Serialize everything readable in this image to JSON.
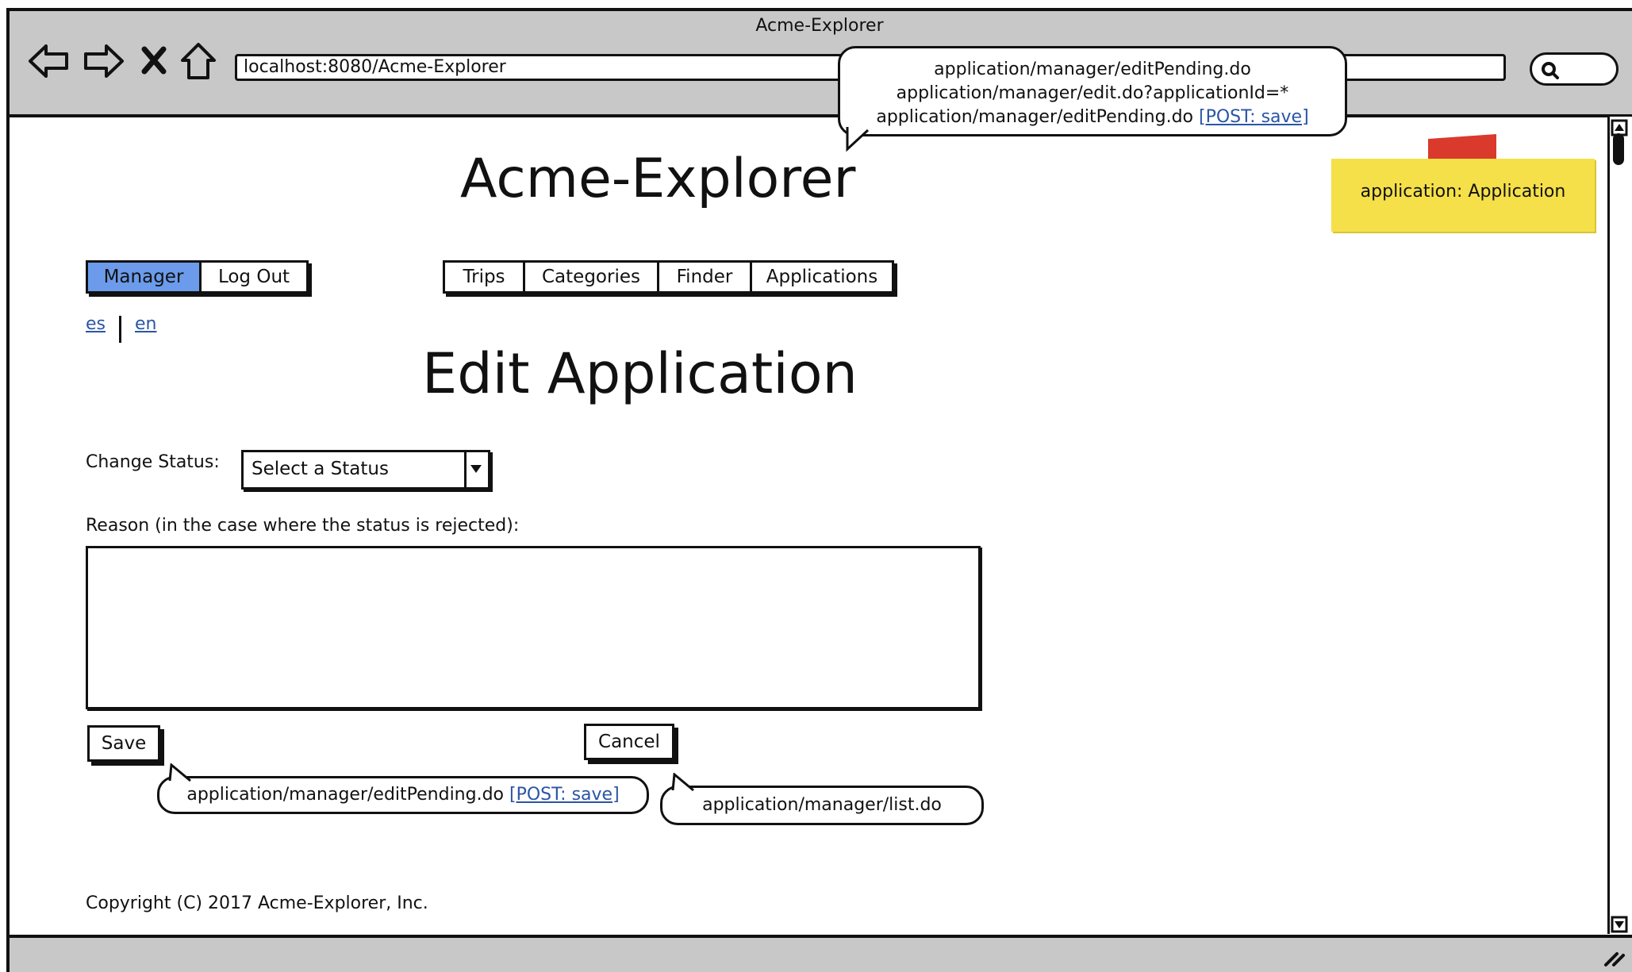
{
  "browser": {
    "window_title": "Acme-Explorer",
    "url": "localhost:8080/Acme-Explorer"
  },
  "annotations": {
    "top_urls": [
      "application/manager/editPending.do",
      "application/manager/edit.do?applicationId=*",
      "application/manager/editPending.do"
    ],
    "top_post": "[POST: save]",
    "save_url": "application/manager/editPending.do",
    "save_post": "[POST: save]",
    "cancel_url": "application/manager/list.do",
    "sticky_note": "application: Application"
  },
  "header": {
    "app_title": "Acme-Explorer",
    "user_menu": [
      "Manager",
      "Log Out"
    ],
    "main_menu": [
      "Trips",
      "Categories",
      "Finder",
      "Applications"
    ],
    "languages": [
      "es",
      "en"
    ]
  },
  "main": {
    "heading": "Edit Application",
    "status_label": "Change Status:",
    "status_value": "Select a Status",
    "reason_label": "Reason (in the case where the status is rejected):",
    "reason_value": "",
    "save_label": "Save",
    "cancel_label": "Cancel"
  },
  "footer": {
    "copyright": "Copyright (C) 2017 Acme-Explorer, Inc."
  }
}
